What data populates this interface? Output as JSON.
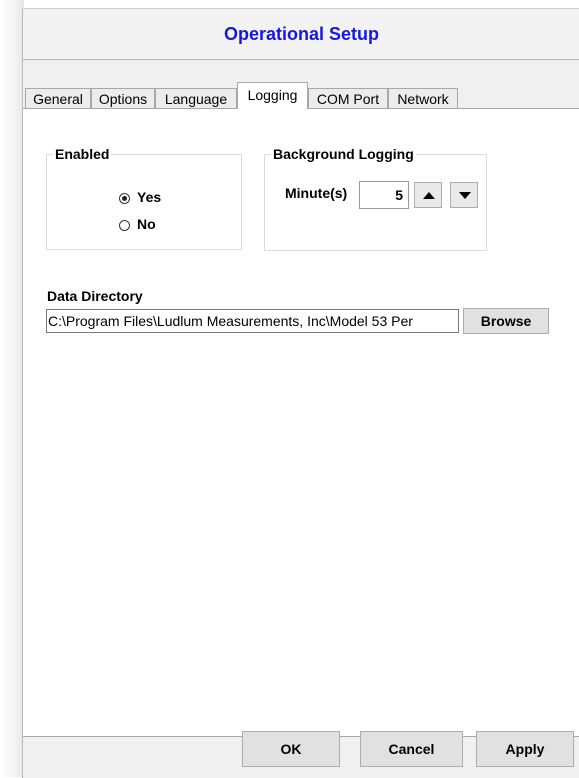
{
  "window": {
    "title": "Operational Setup"
  },
  "tabs": [
    {
      "label": "General",
      "active": false
    },
    {
      "label": "Options",
      "active": false
    },
    {
      "label": "Language",
      "active": false
    },
    {
      "label": "Logging",
      "active": true
    },
    {
      "label": "COM Port",
      "active": false
    },
    {
      "label": "Network",
      "active": false
    }
  ],
  "enabled_group": {
    "label": "Enabled",
    "options": [
      {
        "label": "Yes",
        "checked": true
      },
      {
        "label": "No",
        "checked": false
      }
    ]
  },
  "background_logging": {
    "label": "Background Logging",
    "minutes_label": "Minute(s)",
    "minutes_value": "5",
    "up_icon": "triangle-up-icon",
    "down_icon": "triangle-down-icon"
  },
  "data_directory": {
    "label": "Data Directory",
    "path": "C:\\Program Files\\Ludlum Measurements, Inc\\Model 53 Per",
    "browse_label": "Browse"
  },
  "footer": {
    "ok_label": "OK",
    "cancel_label": "Cancel",
    "apply_label": "Apply"
  },
  "colors": {
    "title": "#1717e0",
    "panel": "#ffffff",
    "window": "#f0f0f0"
  }
}
